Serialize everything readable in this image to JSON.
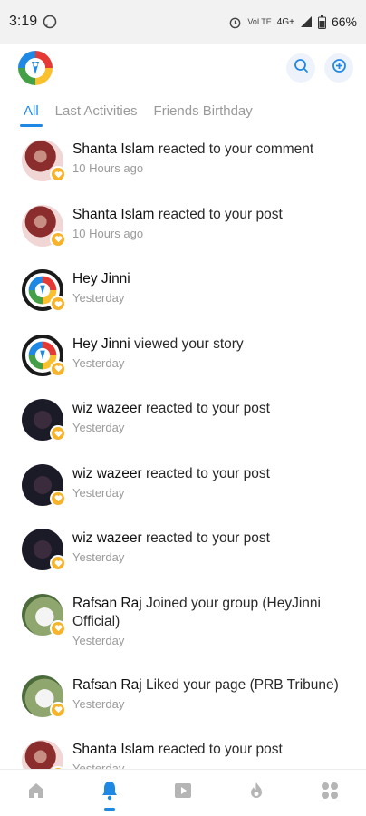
{
  "status_bar": {
    "time": "3:19",
    "battery": "66%",
    "network": "4G+"
  },
  "header": {
    "logo": "heyjinni-logo",
    "search_icon": "search-icon",
    "add_icon": "add-circle-icon"
  },
  "tabs": [
    {
      "label": "All",
      "active": true
    },
    {
      "label": "Last Activities",
      "active": false
    },
    {
      "label": "Friends Birthday",
      "active": false
    }
  ],
  "notifications": [
    {
      "name": "Shanta Islam",
      "action": " reacted to your comment",
      "time": "10 Hours ago",
      "avatar": "shanta"
    },
    {
      "name": "Shanta Islam",
      "action": " reacted to your post",
      "time": "10 Hours ago",
      "avatar": "shanta"
    },
    {
      "name": "Hey Jinni",
      "action": "",
      "time": "Yesterday",
      "avatar": "jinni"
    },
    {
      "name": "Hey Jinni",
      "action": " viewed your story",
      "time": "Yesterday",
      "avatar": "jinni"
    },
    {
      "name": "wiz wazeer",
      "action": " reacted to your post",
      "time": "Yesterday",
      "avatar": "wiz"
    },
    {
      "name": "wiz wazeer",
      "action": " reacted to your post",
      "time": "Yesterday",
      "avatar": "wiz"
    },
    {
      "name": "wiz wazeer",
      "action": " reacted to your post",
      "time": "Yesterday",
      "avatar": "wiz"
    },
    {
      "name": "Rafsan Raj",
      "action": " Joined your group (HeyJinni Official)",
      "time": "Yesterday",
      "avatar": "rafsan"
    },
    {
      "name": "Rafsan Raj",
      "action": " Liked your page (PRB Tribune)",
      "time": "Yesterday",
      "avatar": "rafsan"
    },
    {
      "name": "Shanta Islam",
      "action": " reacted to your post",
      "time": "Yesterday",
      "avatar": "shanta"
    }
  ],
  "bottom_nav": [
    {
      "icon": "home-icon",
      "active": false
    },
    {
      "icon": "bell-icon",
      "active": true
    },
    {
      "icon": "video-icon",
      "active": false
    },
    {
      "icon": "fire-icon",
      "active": false
    },
    {
      "icon": "grid-menu-icon",
      "active": false
    }
  ],
  "colors": {
    "accent": "#1e88e5",
    "badge": "#f7b32b"
  }
}
